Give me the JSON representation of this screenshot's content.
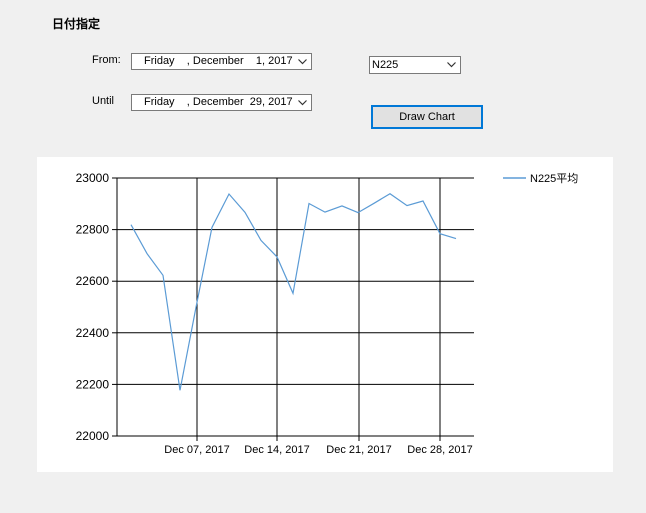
{
  "form": {
    "title": "日付指定",
    "from_label": "From:",
    "until_label": "Until",
    "from_date": "Friday    , December    1, 2017",
    "until_date": "Friday    , December  29, 2017",
    "index_select": "N225",
    "draw_button": "Draw Chart"
  },
  "chart_data": {
    "type": "line",
    "title": "",
    "xlabel": "",
    "ylabel": "",
    "ylim": [
      22000,
      23000
    ],
    "yticks": [
      "23000",
      "22800",
      "22600",
      "22400",
      "22200",
      "22000"
    ],
    "xticks": [
      "Dec 07, 2017",
      "Dec 14, 2017",
      "Dec 21, 2017",
      "Dec 28, 2017"
    ],
    "legend_position": "top-right",
    "color": "#5b9bd5",
    "series": [
      {
        "name": "N225平均",
        "x": [
          "Dec 01",
          "Dec 02",
          "Dec 04",
          "Dec 05",
          "Dec 06",
          "Dec 07",
          "Dec 08",
          "Dec 11",
          "Dec 12",
          "Dec 13",
          "Dec 14",
          "Dec 15",
          "Dec 18",
          "Dec 19",
          "Dec 20",
          "Dec 21",
          "Dec 22",
          "Dec 25",
          "Dec 26",
          "Dec 27",
          "Dec 28",
          "Dec 29"
        ],
        "values": [
          22819,
          22707,
          22623,
          22177,
          22499,
          22809,
          22938,
          22867,
          22758,
          22694,
          22553,
          22901,
          22868,
          22892,
          22866,
          22902,
          22939,
          22893,
          22911,
          22784,
          22765,
          22765
        ]
      }
    ]
  }
}
